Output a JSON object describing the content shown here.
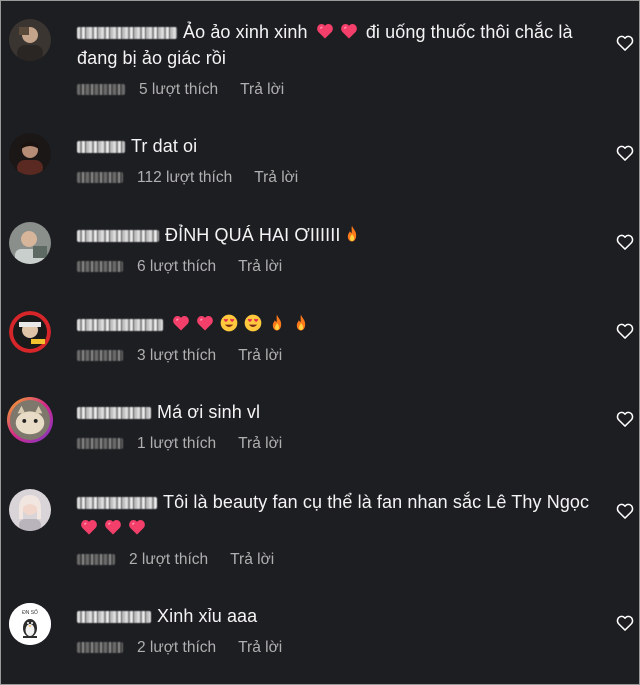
{
  "colors": {
    "background": "#1d1e22",
    "text": "#f4f4f4",
    "meta_text": "#b0b0b0",
    "emoji_heart": "#f43f6a",
    "emoji_fire": "#ff7a1a"
  },
  "comments": [
    {
      "text": "Ảo ảo xinh xinh",
      "text_after": "đi uống thuốc thôi chắc là",
      "text_line2": "đang bị ảo giác rồi",
      "likes": "5 lượt thích",
      "reply": "Trả lời",
      "emojis": [
        "heart-emoji",
        "heart-emoji"
      ],
      "avatar_icon": "user-avatar-photo"
    },
    {
      "text": "Tr dat oi",
      "likes": "112 lượt thích",
      "reply": "Trả lời",
      "avatar_icon": "user-avatar-photo"
    },
    {
      "text": "ĐỈNH QUÁ HAI ƠIIIIII",
      "likes": "6 lượt thích",
      "reply": "Trả lời",
      "emojis": [
        "fire-emoji"
      ],
      "avatar_icon": "user-avatar-photo"
    },
    {
      "text": "",
      "likes": "3 lượt thích",
      "reply": "Trả lời",
      "emojis": [
        "heart-emoji",
        "heart-emoji",
        "heart-eyes-emoji",
        "heart-eyes-emoji",
        "fire-emoji",
        "fire-emoji"
      ],
      "avatar_icon": "user-avatar-photo"
    },
    {
      "text": "Má ơi sinh vl",
      "likes": "1 lượt thích",
      "reply": "Trả lời",
      "avatar_icon": "user-avatar-photo"
    },
    {
      "text": "Tôi là beauty fan cụ thể là fan nhan sắc Lê Thy Ngọc",
      "likes": "2 lượt thích",
      "reply": "Trả lời",
      "emojis": [
        "heart-emoji",
        "heart-emoji",
        "heart-emoji"
      ],
      "avatar_icon": "user-avatar-photo"
    },
    {
      "text": "Xinh xỉu aaa",
      "likes": "2 lượt thích",
      "reply": "Trả lời",
      "avatar_icon": "user-avatar-logo",
      "avatar_label": "ĐN SỐ"
    }
  ]
}
